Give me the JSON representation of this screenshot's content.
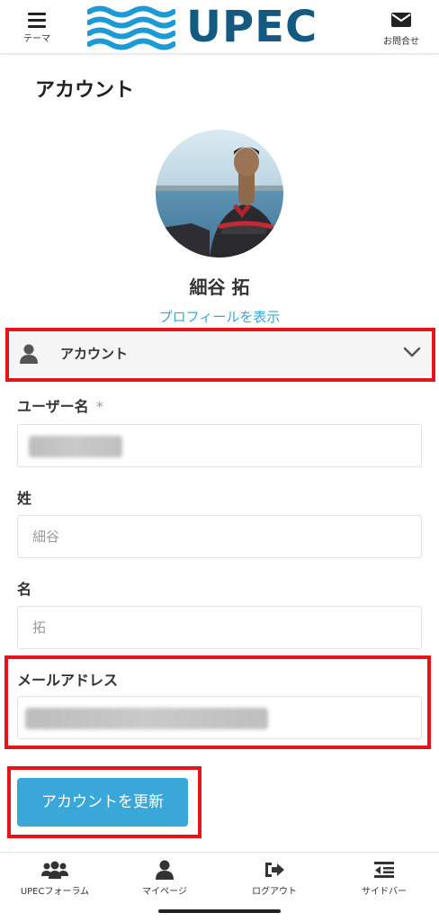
{
  "header": {
    "menu_label": "テーマ",
    "brand": "UPEC",
    "contact_label": "お問合せ",
    "brand_color": "#14597f"
  },
  "page": {
    "title": "アカウント"
  },
  "profile": {
    "name": "細谷 拓",
    "link_label": "プロフィールを表示"
  },
  "account_section": {
    "label": "アカウント",
    "icon": "person-icon",
    "toggle_icon": "chevron-down-icon"
  },
  "form": {
    "username": {
      "label": "ユーザー名",
      "required_mark": "*"
    },
    "last_name": {
      "label": "姓",
      "placeholder": "細谷"
    },
    "first_name": {
      "label": "名",
      "placeholder": "拓"
    },
    "email": {
      "label": "メールアドレス"
    },
    "submit_label": "アカウントを更新"
  },
  "bottom_nav": {
    "items": [
      {
        "label": "UPECフォーラム",
        "icon": "users-icon"
      },
      {
        "label": "マイページ",
        "icon": "user-icon"
      },
      {
        "label": "ログアウト",
        "icon": "logout-icon"
      },
      {
        "label": "サイドバー",
        "icon": "sidebar-icon"
      }
    ]
  },
  "colors": {
    "accent": "#3aa7d9",
    "highlight": "#e8131a"
  }
}
